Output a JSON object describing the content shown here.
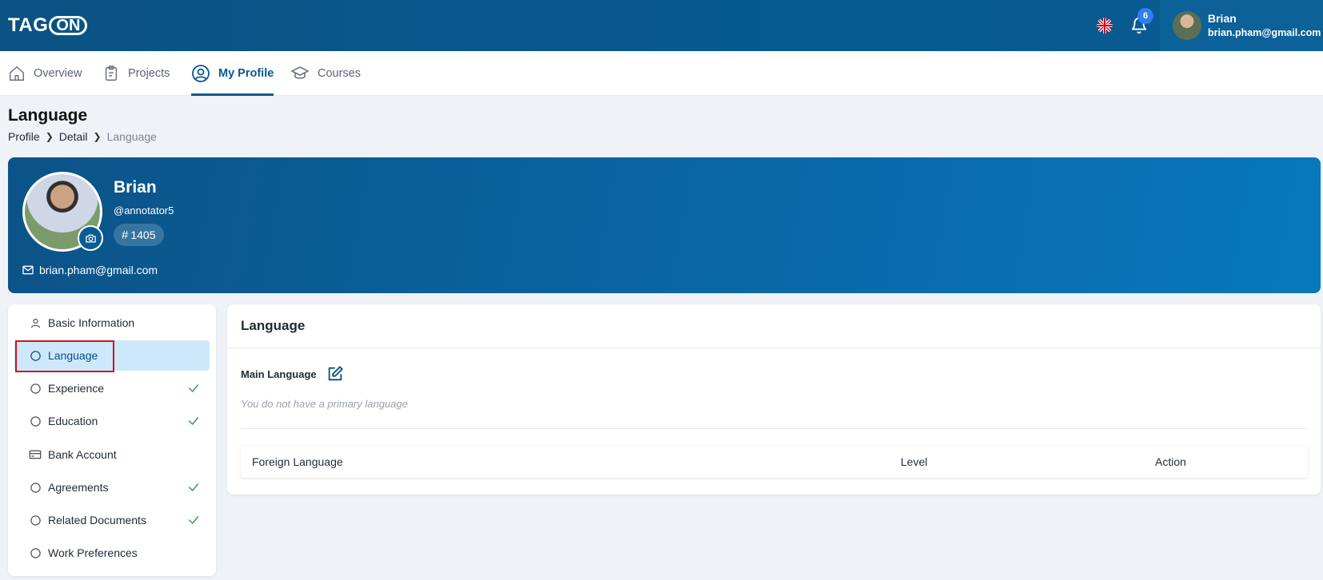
{
  "header": {
    "logo_left": "TAG",
    "logo_pill": "ON",
    "notification_count": "6",
    "user_name": "Brian",
    "user_email": "brian.pham@gmail.com"
  },
  "nav": {
    "tabs": [
      {
        "label": "Overview",
        "icon": "home-icon"
      },
      {
        "label": "Projects",
        "icon": "clipboard-icon"
      },
      {
        "label": "My Profile",
        "icon": "user-circle-icon",
        "active": true
      },
      {
        "label": "Courses",
        "icon": "graduation-cap-icon"
      }
    ]
  },
  "page": {
    "title": "Language",
    "breadcrumb": [
      "Profile",
      "Detail",
      "Language"
    ]
  },
  "profile": {
    "name": "Brian",
    "handle": "@annotator5",
    "id": "1405",
    "id_prefix": "#",
    "email": "brian.pham@gmail.com"
  },
  "sidebar": {
    "items": [
      {
        "label": "Basic Information",
        "icon": "user-icon",
        "checked": false
      },
      {
        "label": "Language",
        "icon": "circle-icon",
        "checked": false,
        "active": true
      },
      {
        "label": "Experience",
        "icon": "circle-icon",
        "checked": true
      },
      {
        "label": "Education",
        "icon": "circle-icon",
        "checked": true
      },
      {
        "label": "Bank Account",
        "icon": "card-icon",
        "checked": false
      },
      {
        "label": "Agreements",
        "icon": "circle-icon",
        "checked": true
      },
      {
        "label": "Related Documents",
        "icon": "circle-icon",
        "checked": true
      },
      {
        "label": "Work Preferences",
        "icon": "circle-icon",
        "checked": false
      }
    ]
  },
  "language_card": {
    "title": "Language",
    "main_language_label": "Main Language",
    "empty_note": "You do not have a primary language",
    "table_headers": [
      "Foreign Language",
      "Level",
      "Action"
    ]
  },
  "colors": {
    "primary": "#075a92",
    "active_bg": "#cde8fb",
    "check": "#2e9e5b",
    "badge": "#2f80ed",
    "highlight": "#d0111c"
  }
}
